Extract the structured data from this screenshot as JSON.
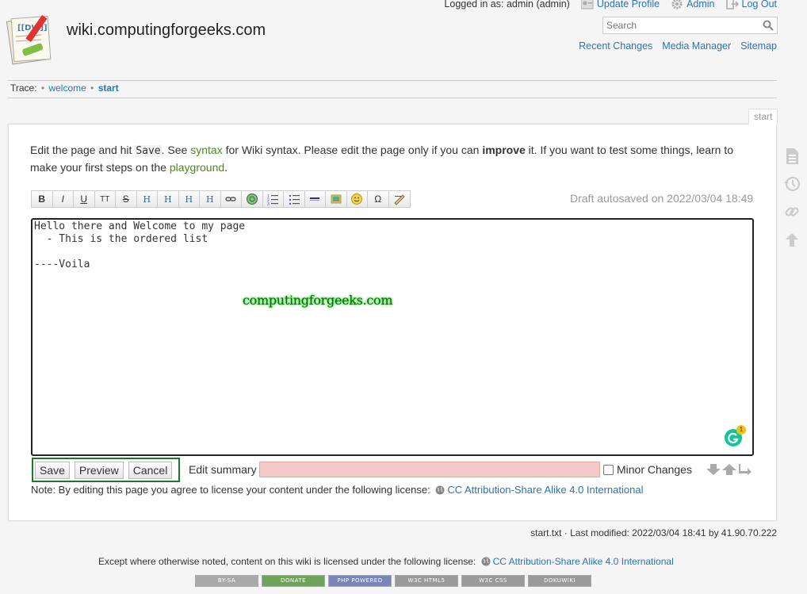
{
  "header": {
    "site_title": "wiki.computingforgeeks.com",
    "logo_icon": "dokuwiki-logo",
    "user": {
      "logged_in": "Logged in as: admin (admin)",
      "update_profile": "Update Profile",
      "admin": "Admin",
      "logout": "Log Out"
    },
    "search": {
      "placeholder": "Search",
      "value": ""
    },
    "site_tools": [
      "Recent Changes",
      "Media Manager",
      "Sitemap"
    ]
  },
  "breadcrumbs": {
    "label": "Trace:",
    "sep": "•",
    "items": [
      "welcome",
      "start"
    ]
  },
  "page": {
    "id": "start",
    "intro": {
      "t1": "Edit the page and hit ",
      "code": "Save",
      "t2": ". See ",
      "link1": "syntax",
      "t3": " for Wiki syntax. Please edit the page only if you can ",
      "bold": "improve",
      "t4": " it. If you want to test some things, learn to make your first steps on the ",
      "link2": "playground",
      "t5": "."
    },
    "toolbar": [
      {
        "name": "bold-button",
        "label": "B"
      },
      {
        "name": "italic-button",
        "label": "I"
      },
      {
        "name": "underline-button",
        "label": "U"
      },
      {
        "name": "monospace-button",
        "label": "TT"
      },
      {
        "name": "strikethrough-button",
        "label": "S"
      },
      {
        "name": "same-level-headline-button",
        "label": "H"
      },
      {
        "name": "lower-headline-button",
        "label": "H"
      },
      {
        "name": "higher-headline-button",
        "label": "H"
      },
      {
        "name": "select-headline-button",
        "label": "H"
      },
      {
        "name": "internal-link-button",
        "label": ""
      },
      {
        "name": "external-link-button",
        "label": ""
      },
      {
        "name": "ordered-list-button",
        "label": ""
      },
      {
        "name": "unordered-list-button",
        "label": ""
      },
      {
        "name": "horizontal-rule-button",
        "label": ""
      },
      {
        "name": "add-images-button",
        "label": ""
      },
      {
        "name": "smileys-button",
        "label": ""
      },
      {
        "name": "special-chars-button",
        "label": "Ω"
      },
      {
        "name": "signature-button",
        "label": ""
      }
    ],
    "draft": "Draft autosaved on 2022/03/04 18:49",
    "editor_text": "Hello there and Welcome to my page\n  - This is the ordered list\n\n----Voila",
    "watermark": "computingforgeeks.com",
    "grammarly_count": "1",
    "buttons": {
      "save": "Save",
      "preview": "Preview",
      "cancel": "Cancel"
    },
    "summary_label": "Edit summary",
    "summary_value": "",
    "minor_changes": "Minor Changes",
    "minor_checked": false,
    "note": "Note: By editing this page you agree to license your content under the following license:",
    "license": "CC Attribution-Share Alike 4.0 International"
  },
  "docinfo": "start.txt · Last modified: 2022/03/04 18:41 by 41.90.70.222",
  "footer": {
    "license_text": "Except where otherwise noted, content on this wiki is licensed under the following license:",
    "license_link": "CC Attribution-Share Alike 4.0 International",
    "badges": [
      {
        "name": "cc-by-sa-badge",
        "label": "BY-SA",
        "color": "#a9a9a9"
      },
      {
        "name": "donate-badge",
        "label": "DONATE",
        "color": "#6fa35c"
      },
      {
        "name": "php-powered-badge",
        "label": "PHP POWERED",
        "color": "#7a86b8"
      },
      {
        "name": "w3c-html5-badge",
        "label": "W3C HTML5",
        "color": "#9a9a9a"
      },
      {
        "name": "w3c-css-badge",
        "label": "W3C CSS",
        "color": "#9a9a9a"
      },
      {
        "name": "dokuwiki-badge",
        "label": "DOKUWIKI",
        "color": "#9a9a9a"
      }
    ]
  },
  "colors": {
    "link": "#2b73b7",
    "wiki_link": "#4a8c1a",
    "highlight_border": "#1a7a2a",
    "summary_bg": "#f3c9c9"
  }
}
